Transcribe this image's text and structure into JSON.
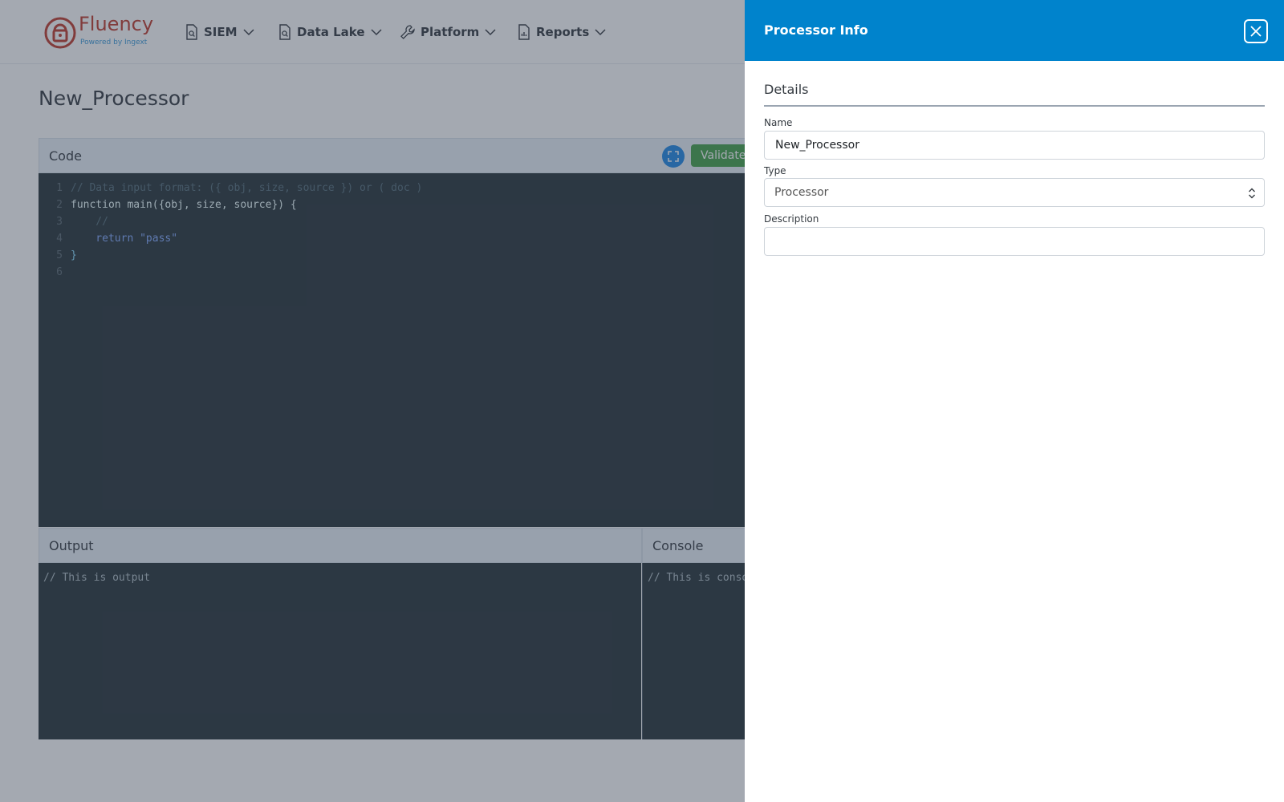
{
  "nav": {
    "brand": "Fluency",
    "brand_sub": "Powered by Ingext",
    "items": [
      {
        "label": "SIEM",
        "icon": "document-search-icon"
      },
      {
        "label": "Data Lake",
        "icon": "document-search-icon"
      },
      {
        "label": "Platform",
        "icon": "wrench-icon"
      },
      {
        "label": "Reports",
        "icon": "document-chart-icon"
      }
    ]
  },
  "page": {
    "title": "New_Processor"
  },
  "code_panel": {
    "header": "Code",
    "validate_label": "Validate",
    "lines": [
      {
        "n": "1",
        "text": "// Data input format: ({ obj, size, source }) or ( doc )"
      },
      {
        "n": "2",
        "text": "function main({obj, size, source}) {"
      },
      {
        "n": "3",
        "text": "    //"
      },
      {
        "n": "4",
        "text": "    return \"pass\""
      },
      {
        "n": "5",
        "text": "}"
      },
      {
        "n": "6",
        "text": ""
      }
    ]
  },
  "output_panel": {
    "header": "Output",
    "placeholder": "// This is output"
  },
  "console_panel": {
    "header": "Console",
    "placeholder": "// This is console"
  },
  "drawer": {
    "title": "Processor Info",
    "section": "Details",
    "name_label": "Name",
    "name_value": "New_Processor",
    "type_label": "Type",
    "type_value": "Processor",
    "description_label": "Description",
    "description_value": ""
  },
  "colors": {
    "drawer_header": "#0083cc",
    "validate": "#43a047",
    "editor_bg": "#263238",
    "brand": "#c0392b"
  }
}
